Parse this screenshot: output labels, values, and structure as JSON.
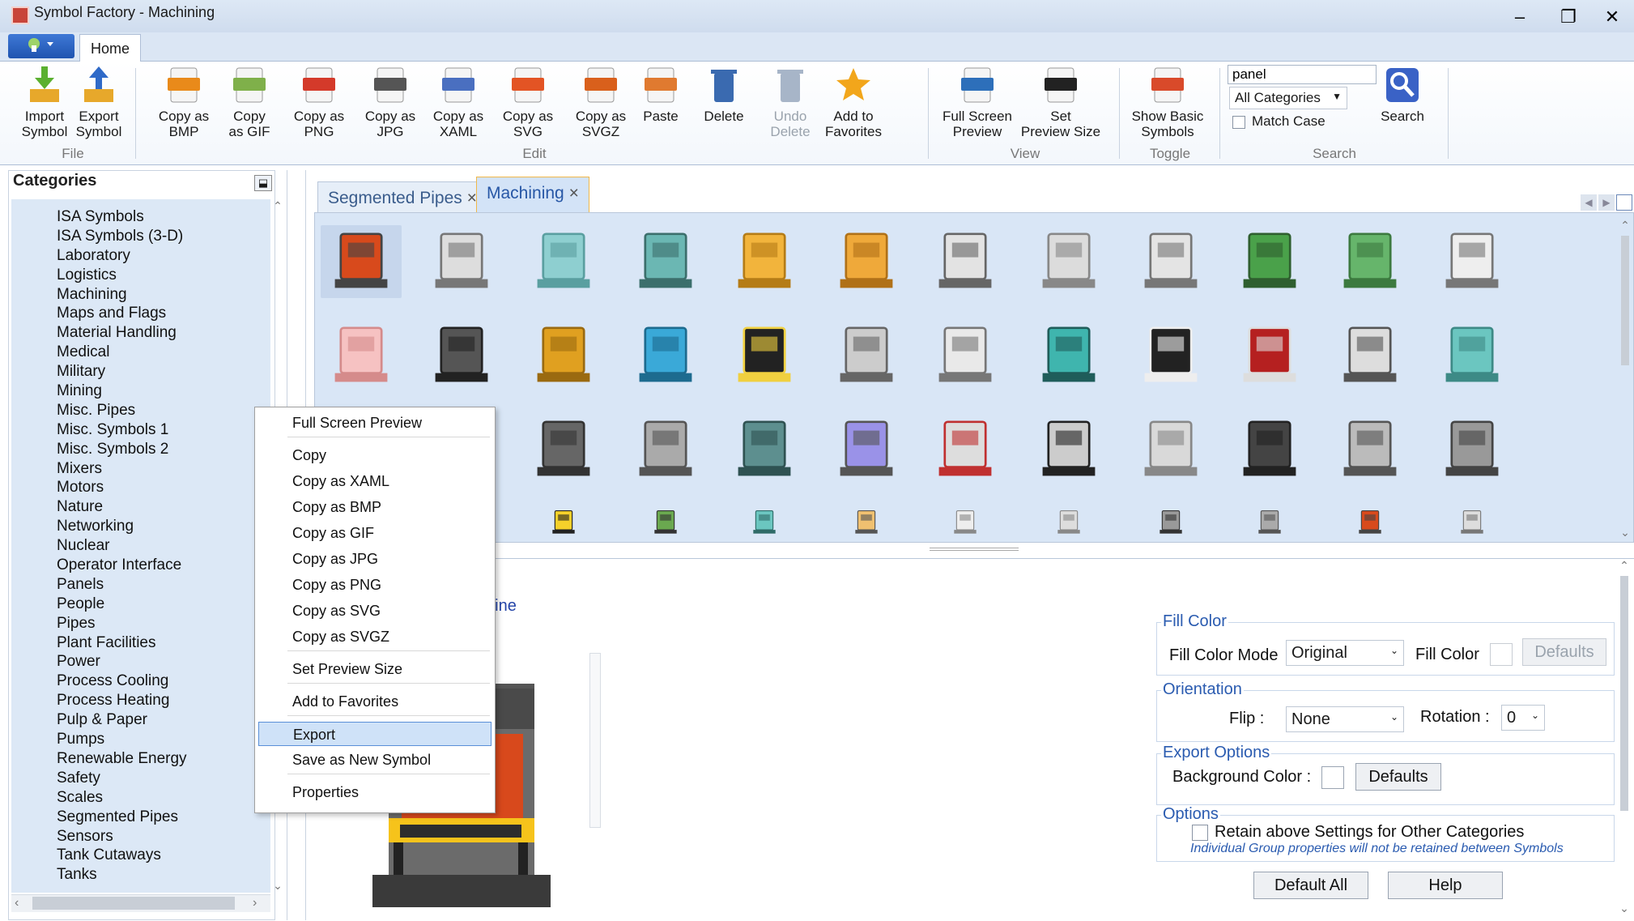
{
  "window": {
    "title": "Symbol Factory - Machining",
    "minimize": "–",
    "restore": "❐",
    "close": "✕"
  },
  "ribbon": {
    "tab": "Home",
    "buttons": [
      {
        "label": "Import\nSymbol",
        "icon": "import-symbol-icon",
        "enabled": true
      },
      {
        "label": "Export\nSymbol",
        "icon": "export-symbol-icon",
        "enabled": true
      },
      {
        "label": "Copy as\nBMP",
        "icon": "bmp-icon",
        "enabled": true
      },
      {
        "label": "Copy\nas GIF",
        "icon": "gif-icon",
        "enabled": true
      },
      {
        "label": "Copy as\nPNG",
        "icon": "png-icon",
        "enabled": true
      },
      {
        "label": "Copy as\nJPG",
        "icon": "jpg-icon",
        "enabled": true
      },
      {
        "label": "Copy as\nXAML",
        "icon": "xaml-icon",
        "enabled": true
      },
      {
        "label": "Copy as\nSVG",
        "icon": "svg-icon",
        "enabled": true
      },
      {
        "label": "Copy as\nSVGZ",
        "icon": "svgz-icon",
        "enabled": true
      },
      {
        "label": "Paste",
        "icon": "paste-icon",
        "enabled": true
      },
      {
        "label": "Delete",
        "icon": "delete-icon",
        "enabled": true
      },
      {
        "label": "Undo\nDelete",
        "icon": "undo-delete-icon",
        "enabled": false
      },
      {
        "label": "Add to\nFavorites",
        "icon": "star-icon",
        "enabled": true
      },
      {
        "label": "Full Screen\nPreview",
        "icon": "fullscreen-icon",
        "enabled": true
      },
      {
        "label": "Set\nPreview Size",
        "icon": "camera-icon",
        "enabled": true
      },
      {
        "label": "Show Basic\nSymbols",
        "icon": "basic-symbols-icon",
        "enabled": true
      },
      {
        "label": "Search",
        "icon": "search-icon",
        "enabled": true
      }
    ],
    "groups": [
      "File",
      "Edit",
      "View",
      "Toggle",
      "Search"
    ],
    "search": {
      "value": "panel",
      "category": "All Categories",
      "match_case": "Match Case"
    }
  },
  "categories": {
    "title": "Categories",
    "pin": "⬓",
    "items": [
      "ISA Symbols",
      "ISA Symbols (3-D)",
      "Laboratory",
      "Logistics",
      "Machining",
      "Maps and Flags",
      "Material Handling",
      "Medical",
      "Military",
      "Mining",
      "Misc. Pipes",
      "Misc. Symbols 1",
      "Misc. Symbols 2",
      "Mixers",
      "Motors",
      "Nature",
      "Networking",
      "Nuclear",
      "Operator Interface",
      "Panels",
      "People",
      "Pipes",
      "Plant Facilities",
      "Power",
      "Process Cooling",
      "Process Heating",
      "Pulp & Paper",
      "Pumps",
      "Renewable Energy",
      "Safety",
      "Scales",
      "Segmented Pipes",
      "Sensors",
      "Tank Cutaways",
      "Tanks"
    ],
    "selected": "Machining"
  },
  "tabs": [
    {
      "label": "Segmented Pipes",
      "close": "×"
    },
    {
      "label": "Machining",
      "close": "×",
      "active": true
    }
  ],
  "preview": {
    "title_fragment": "hine"
  },
  "properties": {
    "fill_color": {
      "title": "Fill Color",
      "mode_label": "Fill Color Mode",
      "mode_value": "Original",
      "color_label": "Fill Color",
      "defaults": "Defaults"
    },
    "orientation": {
      "title": "Orientation",
      "flip_label": "Flip :",
      "flip_value": "None",
      "rotation_label": "Rotation :",
      "rotation_value": "0"
    },
    "export_options": {
      "title": "Export Options",
      "bg_label": "Background Color :",
      "defaults": "Defaults"
    },
    "options": {
      "title": "Options",
      "retain": "Retain above Settings for Other Categories",
      "note": "Individual Group properties will not be retained between Symbols"
    },
    "default_all": "Default All",
    "help": "Help"
  },
  "context_menu": {
    "items": [
      "Full Screen Preview",
      "Copy",
      "Copy as XAML",
      "Copy as BMP",
      "Copy as GIF",
      "Copy as JPG",
      "Copy as PNG",
      "Copy as SVG",
      "Copy as SVGZ",
      "Set Preview Size",
      "Add to Favorites",
      "Export",
      "Save as New Symbol",
      "Properties"
    ],
    "highlighted": "Export"
  }
}
